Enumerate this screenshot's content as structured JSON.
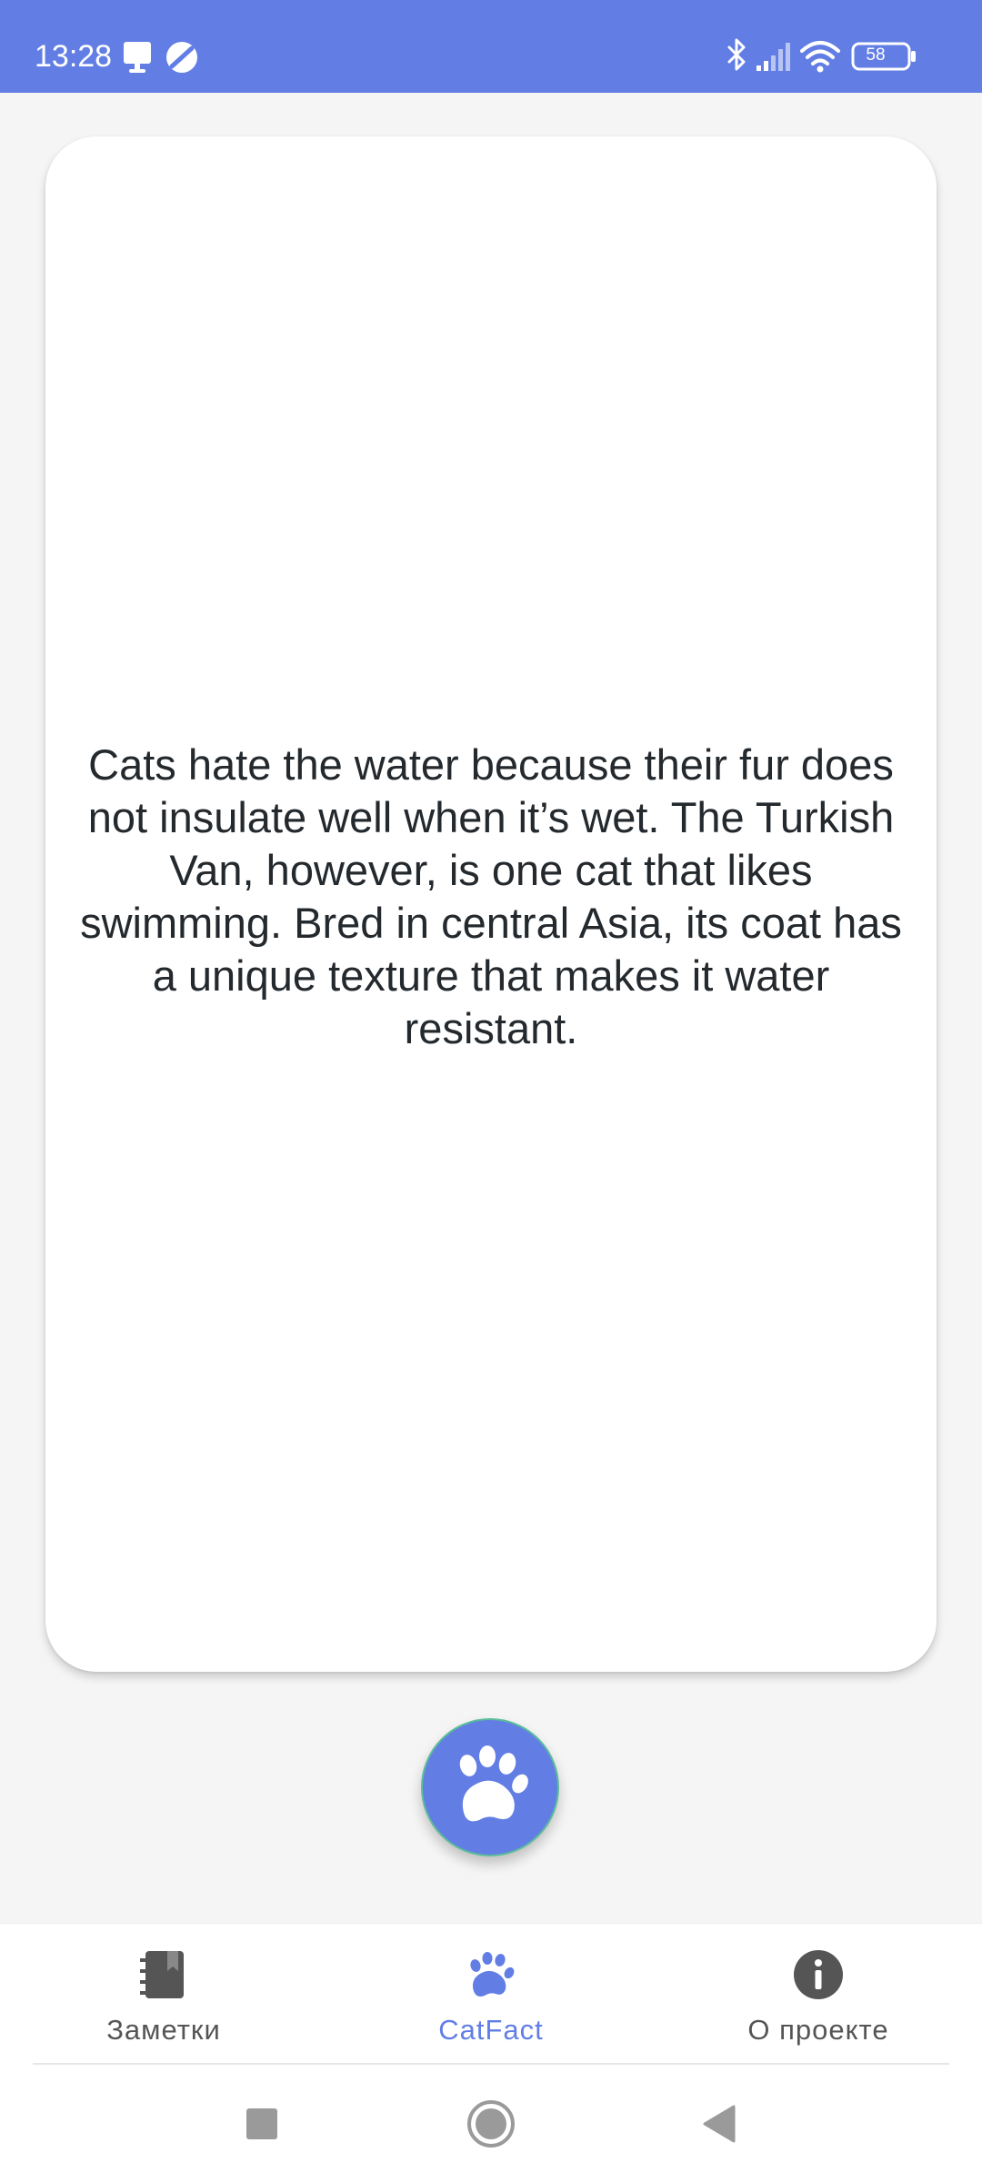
{
  "status_bar": {
    "time": "13:28",
    "battery": "58",
    "background_color": "#627ee4",
    "left_icons": [
      "notification-icon",
      "dnd-icon"
    ],
    "right_icons": [
      "bluetooth-icon",
      "signal-icon",
      "wifi-icon",
      "battery-icon"
    ]
  },
  "fact_card": {
    "text": "Cats hate the water because their fur does not insulate well when it’s wet. The Turkish Van, however, is one cat that likes swimming. Bred in central Asia, its coat has a unique texture that makes it water resistant."
  },
  "fab": {
    "icon": "paw-icon",
    "color": "#627ee4"
  },
  "bottom_nav": {
    "active_color": "#627ee4",
    "items": [
      {
        "label": "Заметки",
        "icon": "notebook-icon",
        "active": false
      },
      {
        "label": "CatFact",
        "icon": "paw-icon",
        "active": true
      },
      {
        "label": "О проекте",
        "icon": "info-icon",
        "active": false
      }
    ]
  },
  "system_nav": {
    "buttons": [
      "recents-button",
      "home-button",
      "back-button"
    ]
  }
}
